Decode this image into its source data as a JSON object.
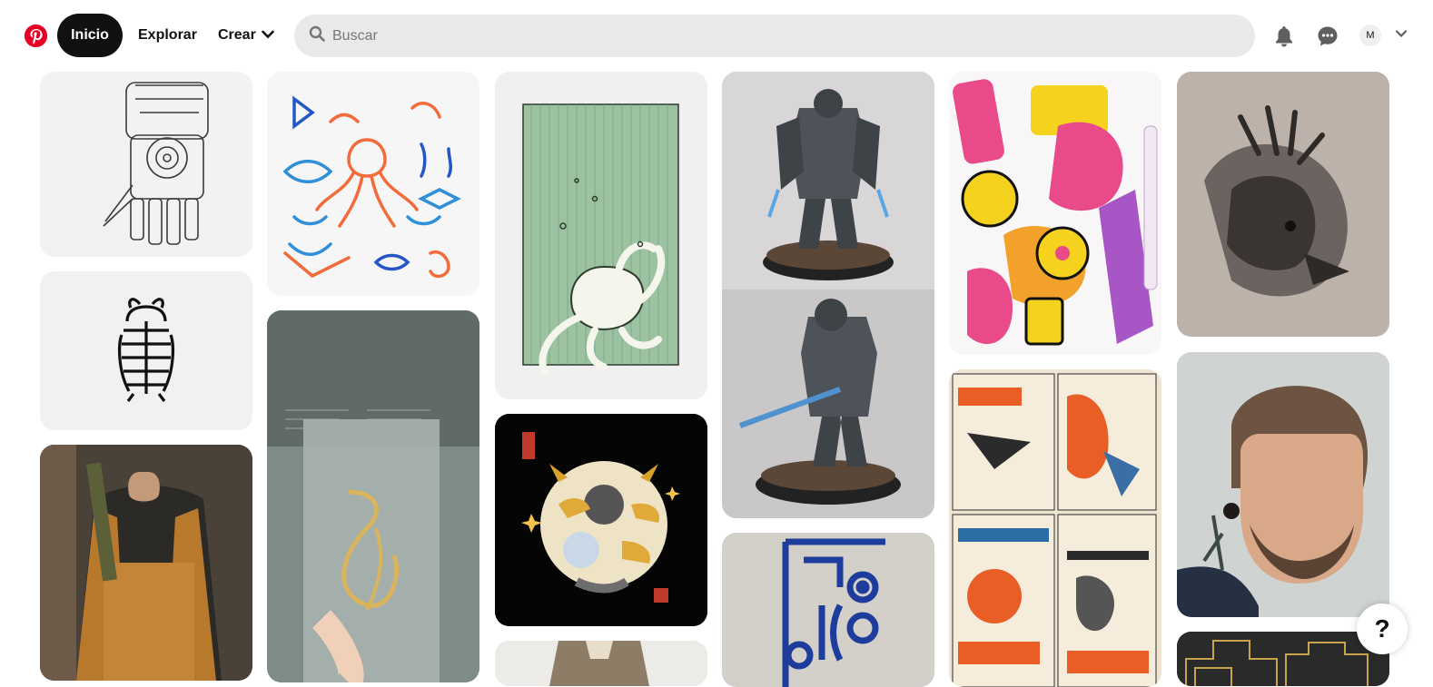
{
  "header": {
    "logo": "pinterest-logo",
    "nav": {
      "home": "Inicio",
      "explore": "Explorar",
      "create": "Crear"
    },
    "search": {
      "placeholder": "Buscar",
      "value": ""
    },
    "avatar_initial": "M"
  },
  "help_button": "?",
  "pins": [
    {
      "name": "pin-robot-hand-sketch",
      "colors": [
        "#f2f2f2",
        "#3a3a3a"
      ]
    },
    {
      "name": "pin-sea-creatures-line-art",
      "colors": [
        "#f6f6f6",
        "#f26b3a",
        "#2f8fd9"
      ]
    },
    {
      "name": "pin-octopus-engraving",
      "colors": [
        "#f0f0f0",
        "#9cc2a2"
      ]
    },
    {
      "name": "pin-space-marine-miniature",
      "colors": [
        "#d4d2d3",
        "#4d5358"
      ]
    },
    {
      "name": "pin-graffiti-doodle-art",
      "colors": [
        "#ffffff",
        "#e84a8a",
        "#f5d21d"
      ]
    },
    {
      "name": "pin-eagle-chest-tattoo",
      "colors": [
        "#b9aea6",
        "#2e2a28"
      ]
    },
    {
      "name": "pin-beetle-line-logo",
      "colors": [
        "#f1f1f1",
        "#111111"
      ]
    },
    {
      "name": "pin-table-number-sign",
      "colors": [
        "#8f9a98",
        "#d8b45c"
      ]
    },
    {
      "name": "pin-kaiju-illustration",
      "colors": [
        "#050505",
        "#efe3c6"
      ]
    },
    {
      "name": "pin-japanese-retro-posters",
      "colors": [
        "#f2e6d3",
        "#e85e25",
        "#2b2b2b"
      ]
    },
    {
      "name": "pin-blue-folk-pattern",
      "colors": [
        "#d9d6d0",
        "#1d3c9c"
      ]
    },
    {
      "name": "pin-mens-haircut",
      "colors": [
        "#c8c8c6",
        "#6d5442"
      ]
    },
    {
      "name": "pin-overalls-fashion",
      "colors": [
        "#3b3630",
        "#b8792d"
      ]
    },
    {
      "name": "pin-jacket-fashion",
      "colors": [
        "#e8e6e2",
        "#8d7d66"
      ]
    },
    {
      "name": "pin-art-deco-pattern",
      "colors": [
        "#2a2a2a",
        "#c9a44f"
      ]
    }
  ]
}
